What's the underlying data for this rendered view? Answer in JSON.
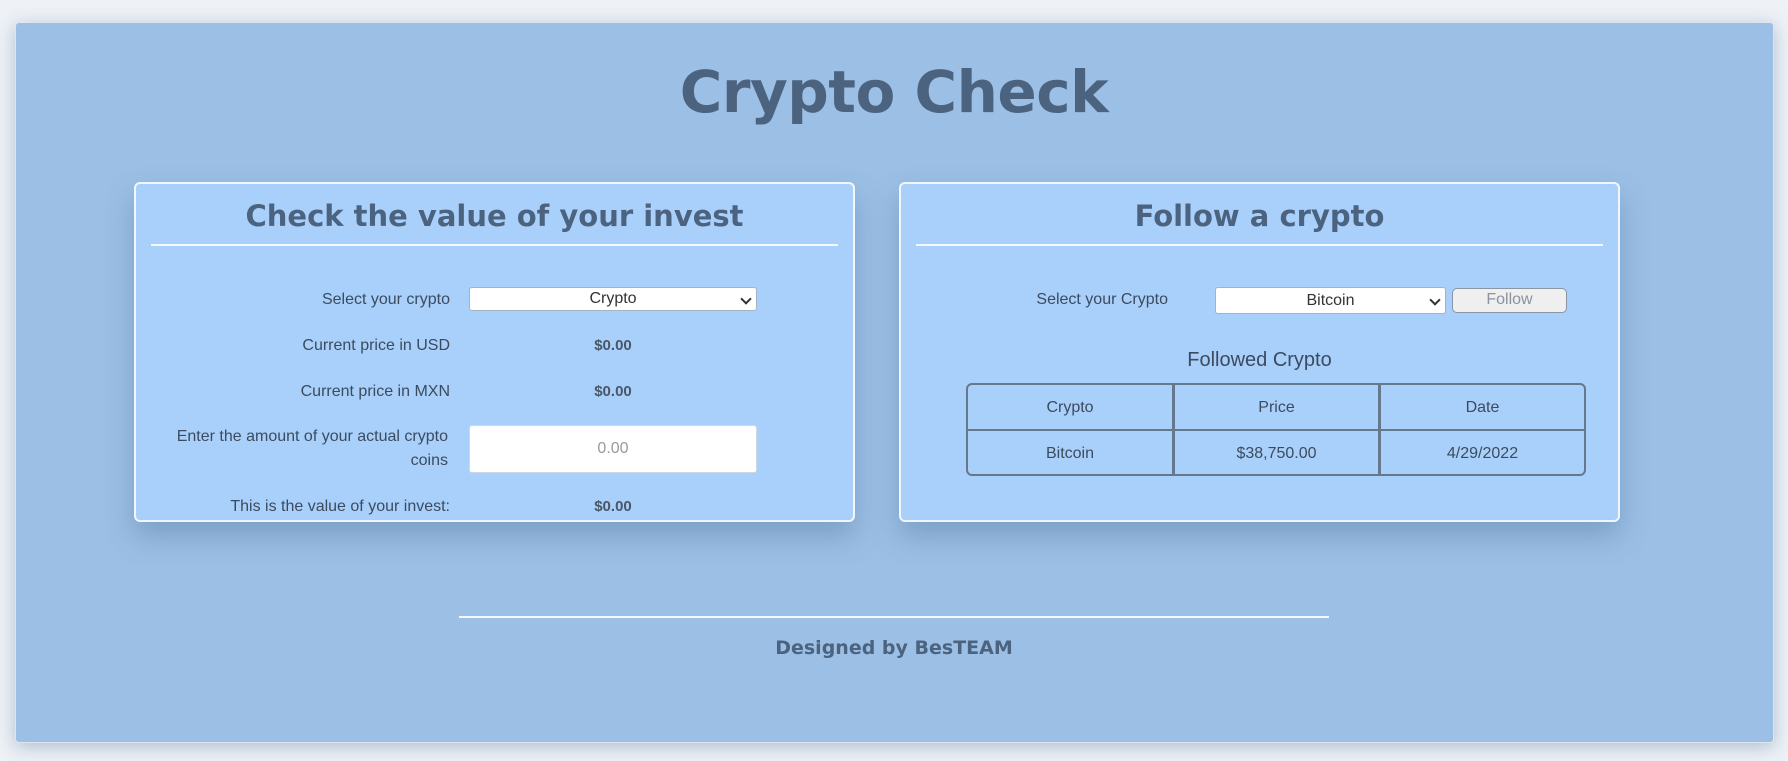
{
  "app": {
    "title": "Crypto Check",
    "footer": "Designed by BesTEAM"
  },
  "invest": {
    "title": "Check the value of your invest",
    "select_label": "Select your crypto",
    "select_value": "Crypto",
    "usd_label": "Current price in USD",
    "usd_value": "$0.00",
    "mxn_label": "Current price in MXN",
    "mxn_value": "$0.00",
    "amount_label_line1": "Enter the amount of your actual crypto",
    "amount_label_line2": "coins",
    "amount_placeholder": "0.00",
    "result_label": "This is the value of your invest:",
    "result_value": "$0.00"
  },
  "follow": {
    "title": "Follow a crypto",
    "select_label": "Select your Crypto",
    "select_value": "Bitcoin",
    "button_label": "Follow",
    "table_title": "Followed Crypto",
    "columns": [
      "Crypto",
      "Price",
      "Date"
    ],
    "rows": [
      [
        "Bitcoin",
        "$38,750.00",
        "4/29/2022"
      ]
    ]
  },
  "colors": {
    "page_bg": "#9bbfe5",
    "card_bg": "#a8d0fb",
    "heading": "#4c6380"
  }
}
